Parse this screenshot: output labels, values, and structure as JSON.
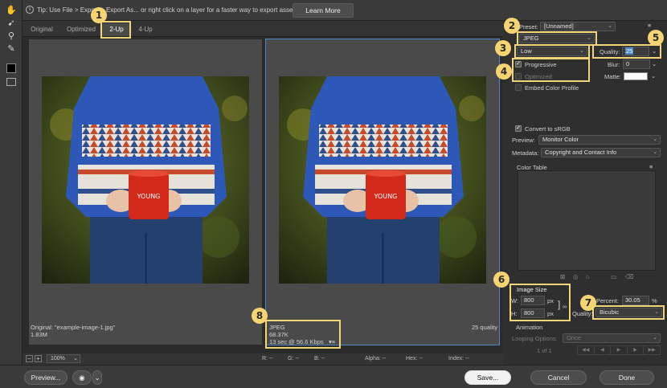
{
  "tip": {
    "text": "Tip: Use File > Export > Export As... or right click on a layer for a faster way to export assets",
    "button": "Learn More"
  },
  "tabs": [
    "Original",
    "Optimized",
    "2-Up",
    "4-Up"
  ],
  "original_pane": {
    "label": "Original: \"example-image-1.jpg\"",
    "size": "1.83M"
  },
  "optimized_pane": {
    "format": "JPEG",
    "size": "68.37K",
    "time": "13 sec @ 56.6 Kbps",
    "quality": "25 quality"
  },
  "bottom": {
    "zoom": "100%",
    "r": "R: --",
    "g": "G: --",
    "b": "B: --",
    "alpha": "Alpha: --",
    "hex": "Hex: --",
    "index": "Index: --"
  },
  "settings": {
    "preset_label": "Preset:",
    "preset": "[Unnamed]",
    "format": "JPEG",
    "quality_level": "Low",
    "quality_label": "Quality:",
    "quality_value": "25",
    "progressive": "Progressive",
    "progressive_checked": true,
    "optimized": "Optimized",
    "embed": "Embed Color Profile",
    "blur_label": "Blur:",
    "blur_value": "0",
    "matte_label": "Matte:",
    "convert": "Convert to sRGB",
    "preview_label": "Preview:",
    "preview_value": "Monitor Color",
    "metadata_label": "Metadata:",
    "metadata_value": "Copyright and Contact Info",
    "color_table": "Color Table",
    "image_size": "Image Size",
    "w_label": "W:",
    "w_value": "800",
    "h_label": "H:",
    "h_value": "800",
    "px": "px",
    "percent_label": "Percent:",
    "percent_value": "30.05",
    "pct": "%",
    "resample_label": "Quality:",
    "resample_value": "Bicubic",
    "animation": "Animation",
    "looping_label": "Looping Options:",
    "looping_value": "Once",
    "frame": "1 of 1"
  },
  "footer": {
    "preview": "Preview...",
    "save": "Save...",
    "cancel": "Cancel",
    "done": "Done"
  },
  "badges": [
    "1",
    "2",
    "3",
    "4",
    "5",
    "6",
    "7",
    "8"
  ],
  "colors": {
    "highlight": "#f2d47a",
    "badge": "#f6d472",
    "selected_pane": "#4d86c9"
  }
}
